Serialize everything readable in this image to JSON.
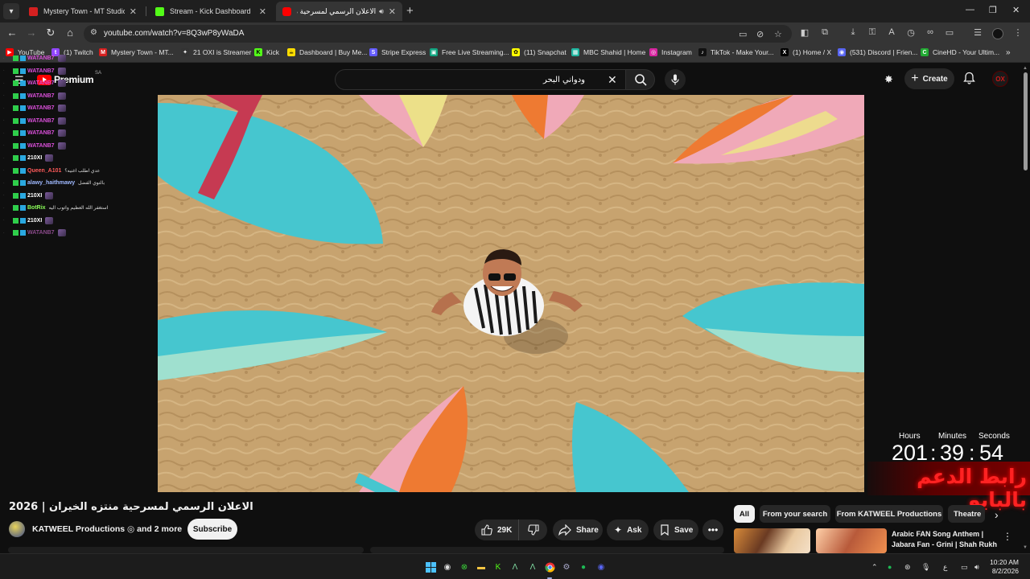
{
  "browser": {
    "tabs": [
      {
        "title": "Mystery Town - MT Studios | M",
        "favicon_color": "#d42020",
        "active": false
      },
      {
        "title": "Stream - Kick Dashboard",
        "favicon_color": "#53fc18",
        "active": false
      },
      {
        "title": "الاعلان الرسمي لمسرحية منتز",
        "favicon_color": "#ff0000",
        "active": true
      }
    ],
    "url": "youtube.com/watch?v=8Q3wP8yWaDA",
    "bookmarks": [
      {
        "label": "YouTube",
        "color": "#ff0000",
        "glyph": "▶"
      },
      {
        "label": "(1) Twitch",
        "color": "#9146ff",
        "glyph": "t"
      },
      {
        "label": "Mystery Town - MT...",
        "color": "#d42020",
        "glyph": "M"
      },
      {
        "label": "21 OXI is Streamer",
        "color": "#333333",
        "glyph": "✦"
      },
      {
        "label": "Kick",
        "color": "#53fc18",
        "glyph": "K"
      },
      {
        "label": "Dashboard | Buy Me...",
        "color": "#ffdd00",
        "glyph": "☕"
      },
      {
        "label": "Stripe Express",
        "color": "#635bff",
        "glyph": "S"
      },
      {
        "label": "Free Live Streaming...",
        "color": "#10a37f",
        "glyph": "▣"
      },
      {
        "label": "(11) Snapchat",
        "color": "#fffc00",
        "glyph": "✿"
      },
      {
        "label": "MBC Shahid | Home",
        "color": "#1fb6a0",
        "glyph": "▦"
      },
      {
        "label": "Instagram",
        "color": "#d6249f",
        "glyph": "◎"
      },
      {
        "label": "TikTok - Make Your...",
        "color": "#111111",
        "glyph": "♪"
      },
      {
        "label": "(1) Home / X",
        "color": "#000000",
        "glyph": "X"
      },
      {
        "label": "(531) Discord | Frien...",
        "color": "#5865f2",
        "glyph": "◉"
      },
      {
        "label": "CineHD - Your Ultim...",
        "color": "#22aa33",
        "glyph": "C"
      }
    ]
  },
  "youtube": {
    "logo_text": "Premium",
    "country_code": "SA",
    "search_value": "ودواني البحر",
    "create_label": "Create",
    "avatar_text": "OX"
  },
  "chat": [
    {
      "user": "WATANB7",
      "msg": "",
      "color": "#d94fd9"
    },
    {
      "user": "WATANB7",
      "msg": "",
      "color": "#d94fd9"
    },
    {
      "user": "WATANB7",
      "msg": "",
      "color": "#d94fd9"
    },
    {
      "user": "WATANB7",
      "msg": "",
      "color": "#d94fd9"
    },
    {
      "user": "WATANB7",
      "msg": "",
      "color": "#d94fd9"
    },
    {
      "user": "WATANB7",
      "msg": "",
      "color": "#d94fd9"
    },
    {
      "user": "WATANB7",
      "msg": "",
      "color": "#d94fd9"
    },
    {
      "user": "WATANB7",
      "msg": "",
      "color": "#d94fd9"
    },
    {
      "user": "210XI",
      "msg": "",
      "color": "#ffffff"
    },
    {
      "user": "Queen_A101",
      "msg": "عدي اطلب اغنيه؟",
      "color": "#ff5a5a"
    },
    {
      "user": "alawy_haithmawy",
      "msg": "بالتوي الفضل",
      "color": "#9fb9ff"
    },
    {
      "user": "210XI",
      "msg": "",
      "color": "#ffffff"
    },
    {
      "user": "BotRix",
      "msg": "استغفر الله العظيم واتوب اليه",
      "color": "#8cff5a"
    },
    {
      "user": "210XI",
      "msg": "",
      "color": "#ffffff"
    },
    {
      "user": "WATANB7",
      "msg": "",
      "color": "#8a4a8a"
    }
  ],
  "stream_overlay": {
    "labels": [
      "Hours",
      "Minutes",
      "Seconds"
    ],
    "hours": "201",
    "minutes": "39",
    "seconds": "54",
    "separator": ":",
    "support_text": "رابط الدعم بالبايو"
  },
  "video": {
    "title": "الاعلان الرسمي لمسرحية منتزه الخيران | 2026",
    "channel": "KATWEEL Productions ◎ and 2 more",
    "subscribe_label": "Subscribe",
    "likes": "29K",
    "share_label": "Share",
    "ask_label": "Ask",
    "save_label": "Save"
  },
  "chips": [
    "All",
    "From your search",
    "From KATWEEL Productions",
    "Theatre"
  ],
  "recommended": {
    "title": "Arabic FAN Song Anthem | Jabara Fan - Grini | Shah Rukh ..."
  },
  "taskbar": {
    "lang": "ع",
    "time": "10:20 AM",
    "date": "8/2/2026"
  },
  "colors": {
    "accent_red": "#ff0000",
    "kick_green": "#53fc18",
    "sand": "#c29e6b",
    "board_teal": "#46c6cf",
    "board_orange": "#ee7a32",
    "board_pink": "#f0a9b8"
  }
}
